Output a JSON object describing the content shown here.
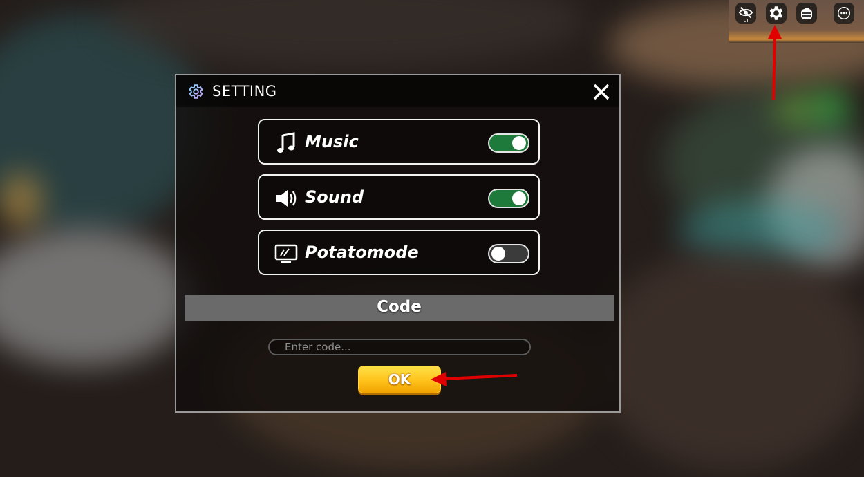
{
  "topbar": {
    "buttons": [
      {
        "name": "hide-ui",
        "icon": "eye-slash-icon",
        "label": "UI"
      },
      {
        "name": "settings",
        "icon": "gear-icon"
      },
      {
        "name": "backpack",
        "icon": "backpack-icon"
      },
      {
        "name": "more",
        "icon": "ellipsis-icon"
      }
    ]
  },
  "panel": {
    "title": "SETTING",
    "title_icon": "gear-outline-icon",
    "close_icon": "close-icon",
    "toggles": [
      {
        "label": "Music",
        "icon": "music-note-icon",
        "state": "on"
      },
      {
        "label": "Sound",
        "icon": "speaker-icon",
        "state": "on"
      },
      {
        "label": "Potatomode",
        "icon": "monitor-icon",
        "state": "off"
      }
    ],
    "code": {
      "section_title": "Code",
      "placeholder": "Enter code...",
      "value": "",
      "submit_label": "OK"
    }
  },
  "colors": {
    "toggle_on": "#1d7a3a",
    "toggle_off": "#3b3b3b",
    "ok_button": "#ffc21a",
    "annotation_arrow": "#e00000"
  }
}
